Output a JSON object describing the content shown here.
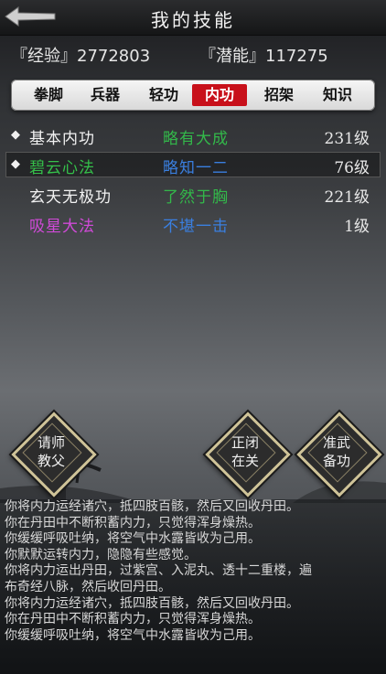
{
  "header": {
    "title": "我的技能",
    "back_icon": "back-arrow-icon"
  },
  "stats": {
    "experience": "『经验』2772803",
    "potential": "『潜能』117275"
  },
  "tabs": [
    {
      "label": "拳脚",
      "active": false
    },
    {
      "label": "兵器",
      "active": false
    },
    {
      "label": "轻功",
      "active": false
    },
    {
      "label": "内功",
      "active": true
    },
    {
      "label": "招架",
      "active": false
    },
    {
      "label": "知识",
      "active": false
    }
  ],
  "skills": [
    {
      "marker": "◆",
      "name": "基本内功",
      "level": "略有大成",
      "grade": "231级",
      "name_color": "#f2f2f2",
      "level_color": "#33b84a"
    },
    {
      "marker": "◆",
      "name": "碧云心法",
      "level": "略知一二",
      "grade": "76级",
      "name_color": "#35c04a",
      "level_color": "#3a7fe0"
    },
    {
      "marker": "",
      "name": "玄天无极功",
      "level": "了然于胸",
      "grade": "221级",
      "name_color": "#f2f2f2",
      "level_color": "#33b84a"
    },
    {
      "marker": "",
      "name": "吸星大法",
      "level": "不堪一击",
      "grade": "1级",
      "name_color": "#d04ad8",
      "level_color": "#3a7fe0"
    }
  ],
  "buttons": {
    "ask_master": "请师\n教父",
    "seclusion": "正闭\n在关",
    "prepare": "准武\n备功"
  },
  "colors": {
    "accent_red": "#c8101a",
    "gold_border": "#cfc398"
  },
  "log": [
    "你将内力运经诸穴，抵四肢百骸，然后又回收丹田。",
    "你在丹田中不断积蓄内力，只觉得浑身燥热。",
    "你缓缓呼吸吐纳，将空气中水露皆收为己用。",
    "你默默运转内力，隐隐有些感觉。",
    "你将内力运出丹田，过紫宫、入泥丸、透十二重楼，遍",
    "布奇经八脉，然后收回丹田。",
    "你将内力运经诸穴，抵四肢百骸，然后又回收丹田。",
    "你在丹田中不断积蓄内力，只觉得浑身燥热。",
    "你缓缓呼吸吐纳，将空气中水露皆收为己用。"
  ]
}
